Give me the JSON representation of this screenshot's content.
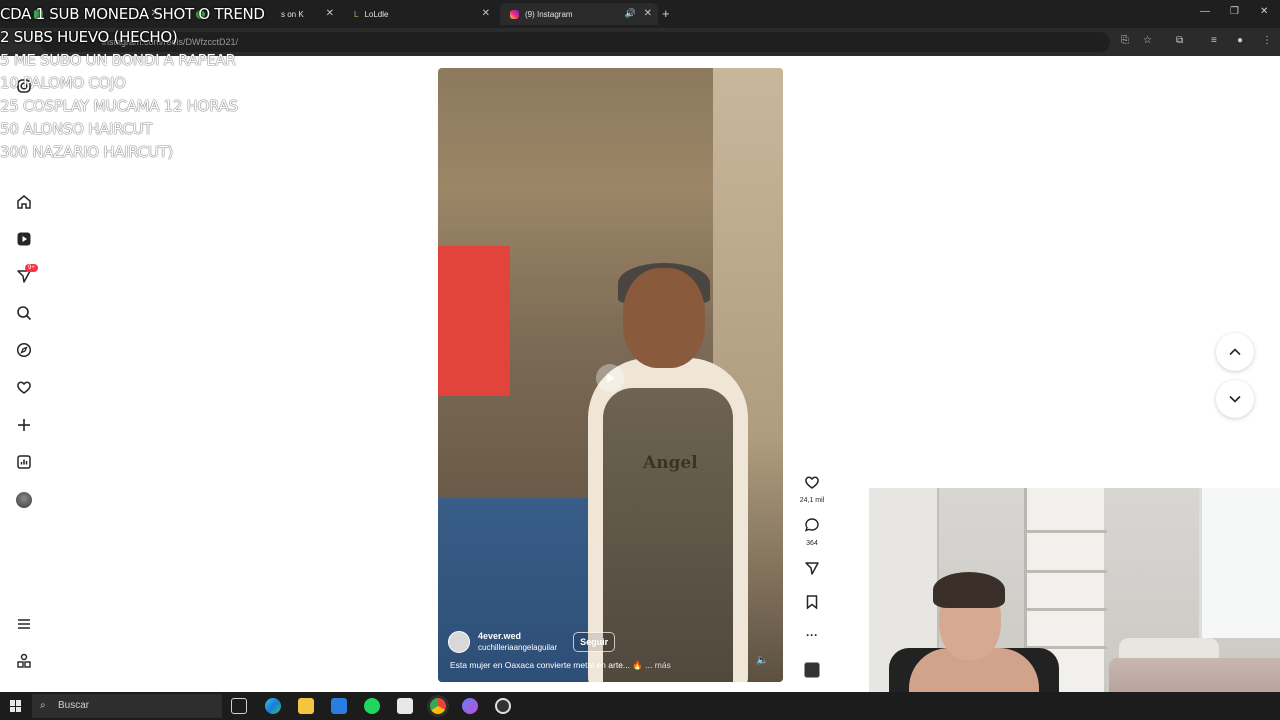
{
  "browser": {
    "tabs": [
      {
        "label": "LoLdle"
      },
      {
        "label": "(9) Instagram"
      }
    ],
    "partial_tab_fragment": "s on K",
    "url": "instagram.com/reels/DWfzcctD21/"
  },
  "overlay": {
    "lines": [
      "CDA 1 SUB MONEDA SHOT O TREND",
      "2 SUBS HUEVO (HECHO)",
      "5 ME SUBO UN BONDI A RAPEAR",
      "10 PALOMO COJO",
      "25 COSPLAY MUCAMA 12 HORAS",
      "50 ALONSO HAIRCUT",
      "300 NAZARIO HAIRCUT)"
    ]
  },
  "nav": {
    "notifications_badge": "9+",
    "icons": [
      "home-icon",
      "reels-icon",
      "messages-icon",
      "search-icon",
      "explore-icon",
      "heart-icon",
      "create-icon",
      "dashboard-icon",
      "profile-avatar",
      "menu-icon",
      "meta-icon"
    ]
  },
  "reel": {
    "author": "4ever.wed",
    "collaborator": "cuchilleriaangelaguilar",
    "follow_label": "Seguir",
    "caption": "Esta mujer en Oaxaca convierte metal en arte... 🔥 ...",
    "more_label": "más",
    "apron_text": "Angel"
  },
  "actions": {
    "likes": "24,1 mil",
    "comments": "364"
  },
  "taskbar": {
    "search_placeholder": "Buscar"
  },
  "colors": {
    "badge": "#ff3040",
    "chrome_dark": "#1f1f1f",
    "taskbar": "#1c1c1c"
  }
}
